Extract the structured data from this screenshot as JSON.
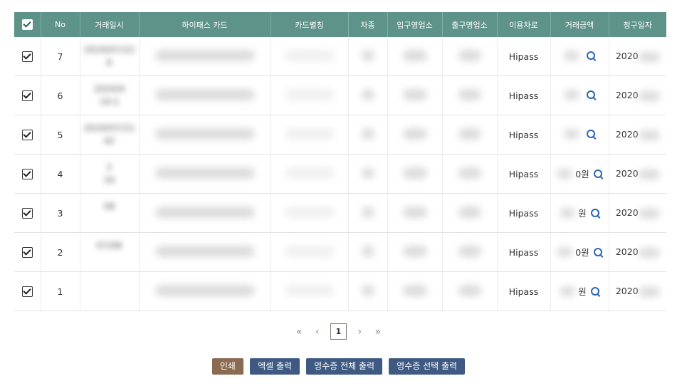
{
  "table": {
    "headers": [
      "No",
      "거래일시",
      "하이패스 카드",
      "카드별칭",
      "차종",
      "입구영업소",
      "출구영업소",
      "이용차로",
      "거래금액",
      "청구일자"
    ],
    "rows": [
      {
        "no": "7",
        "datetime_line1": "2020/07/22",
        "datetime_line2": "6",
        "lane": "Hipass",
        "amount": "",
        "billing": "2020"
      },
      {
        "no": "6",
        "datetime_line1": "2020/0",
        "datetime_line2": "19:1",
        "lane": "Hipass",
        "amount": "",
        "billing": "2020"
      },
      {
        "no": "5",
        "datetime_line1": "2020/07/21",
        "datetime_line2": "42",
        "lane": "Hipass",
        "amount": "",
        "billing": "2020"
      },
      {
        "no": "4",
        "datetime_line1": "2",
        "datetime_line2": "34",
        "lane": "Hipass",
        "amount": "0원",
        "billing": "2020"
      },
      {
        "no": "3",
        "datetime_line1": "08",
        "datetime_line2": "",
        "lane": "Hipass",
        "amount": "원",
        "billing": "2020"
      },
      {
        "no": "2",
        "datetime_line1": "07/08",
        "datetime_line2": "",
        "lane": "Hipass",
        "amount": "0원",
        "billing": "2020"
      },
      {
        "no": "1",
        "datetime_line1": "",
        "datetime_line2": "",
        "lane": "Hipass",
        "amount": "원",
        "billing": "2020"
      }
    ]
  },
  "pagination": {
    "first": "«",
    "prev": "‹",
    "current": "1",
    "next": "›",
    "last": "»"
  },
  "buttons": {
    "print": "인쇄",
    "excel": "엑셀 출력",
    "receipt_all": "영수증 전체 출력",
    "receipt_selected": "영수증 선택 출력"
  },
  "colors": {
    "header_bg": "#5d9388",
    "btn_print": "#8b6a52",
    "btn_other": "#3e5a82",
    "search_icon": "#2a65b0"
  }
}
